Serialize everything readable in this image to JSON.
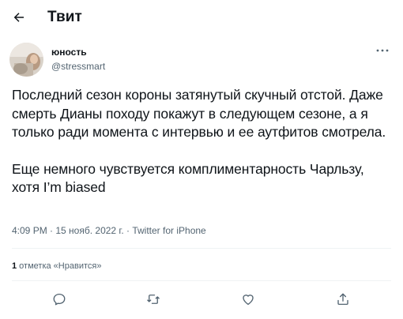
{
  "header": {
    "title": "Твит",
    "back_icon": "arrow-left-icon"
  },
  "author": {
    "display_name": "юность",
    "handle": "@stressmart"
  },
  "more_icon": "more-horizontal-icon",
  "tweet": {
    "paragraphs": [
      "Последний сезон короны затянутый скучный отстой. Даже смерть Дианы походу покажут в следующем сезоне, а я только ради момента с интервью и ее аутфитов смотрела.",
      "Еще немного чувствуется комплиментарность Чарльзу, хотя I’m biased"
    ]
  },
  "meta": {
    "time": "4:09 PM",
    "sep1": " · ",
    "date": "15 нояб. 2022 г.",
    "sep2": " · ",
    "source": "Twitter for iPhone"
  },
  "likes": {
    "count": "1",
    "label": " отметка «Нравится»"
  },
  "actions": [
    {
      "icon": "reply-icon"
    },
    {
      "icon": "retweet-icon"
    },
    {
      "icon": "like-heart-icon"
    },
    {
      "icon": "share-icon"
    }
  ],
  "colors": {
    "text": "#0f1419",
    "secondary": "#536471",
    "divider": "#eff3f4"
  }
}
